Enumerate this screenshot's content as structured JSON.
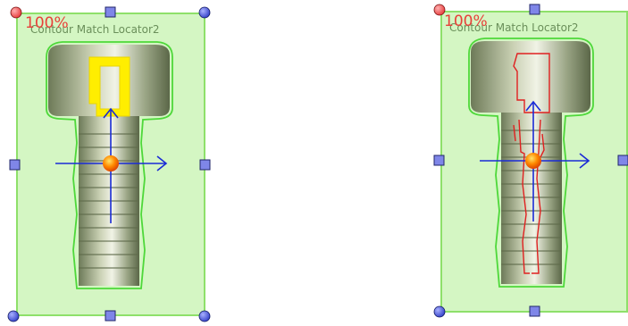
{
  "panels": [
    {
      "percent": "100%",
      "locator_name": "Contour Match Locator2"
    },
    {
      "percent": "100%",
      "locator_name": "Contour Match Locator2"
    }
  ],
  "colors": {
    "roi_fill": "#cdf5b9",
    "roi_border": "#8ee06a",
    "contour_outline": "#4ed83a",
    "model_highlight": "#ffee00",
    "match_edges": "#e02020",
    "axis": "#1a2bd6",
    "center_marker": "#ff8a00",
    "corner_handle": "#4a55d8",
    "edge_handle": "#7f86e8",
    "percent_text": "#e8403a"
  },
  "icons": [
    "circle-handle-icon",
    "square-handle-icon",
    "center-marker-icon",
    "axis-arrow-icon"
  ]
}
